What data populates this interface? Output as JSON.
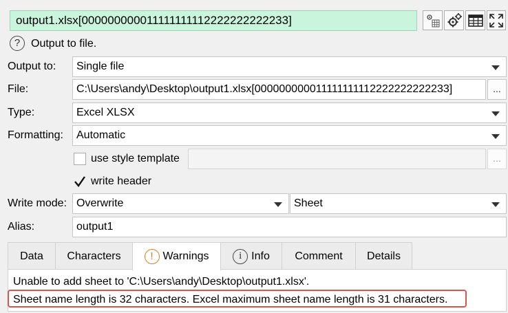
{
  "title": "output1.xlsx[000000000011111111112222222222233]",
  "toolbar": {
    "icons": [
      "node-settings-icon",
      "gear-icon",
      "table-icon",
      "fullscreen-icon"
    ]
  },
  "help": {
    "icon": "help-icon",
    "text": "Output to file."
  },
  "form": {
    "output_to": {
      "label": "Output to:",
      "value": "Single file"
    },
    "file": {
      "label": "File:",
      "value": "C:\\Users\\andy\\Desktop\\output1.xlsx[000000000011111111112222222222233]",
      "browse": "..."
    },
    "type": {
      "label": "Type:",
      "value": "Excel XLSX"
    },
    "formatting": {
      "label": "Formatting:",
      "value": "Automatic"
    },
    "style_template": {
      "label": "use style template",
      "checked": false,
      "browse": "..."
    },
    "write_header": {
      "label": "write header",
      "checked": true
    },
    "write_mode": {
      "label": "Write mode:",
      "value": "Overwrite",
      "sheet": "Sheet"
    },
    "alias": {
      "label": "Alias:",
      "value": "output1"
    }
  },
  "tabs": [
    {
      "label": "Data"
    },
    {
      "label": "Characters"
    },
    {
      "label": "Warnings",
      "icon": "warning-icon",
      "active": true
    },
    {
      "label": "Info",
      "icon": "info-icon"
    },
    {
      "label": "Comment"
    },
    {
      "label": "Details"
    }
  ],
  "warnings": [
    "Unable to add sheet to 'C:\\Users\\andy\\Desktop\\output1.xlsx'.",
    "Sheet name length is 32 characters. Excel maximum sheet name length is 31 characters."
  ],
  "colors": {
    "title_bg": "#c8f5dc",
    "highlight_border": "#d9534f",
    "warning_icon": "#e07a1f"
  }
}
